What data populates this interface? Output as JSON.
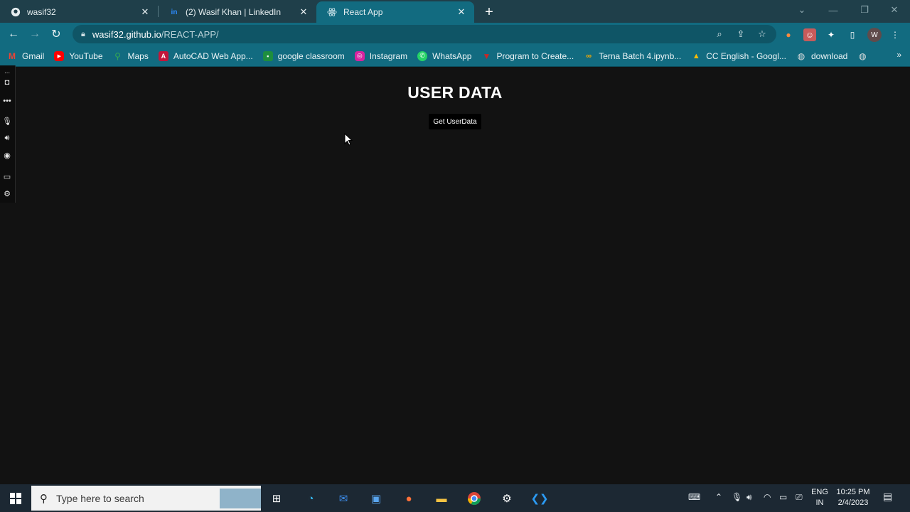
{
  "tabs": [
    {
      "title": "wasif32",
      "icon": "github-icon",
      "active": false
    },
    {
      "title": "(2) Wasif Khan | LinkedIn",
      "icon": "linkedin-icon",
      "active": false
    },
    {
      "title": "React App",
      "icon": "react-icon",
      "active": true
    }
  ],
  "address": {
    "host": "wasif32.github.io",
    "path": "/REACT-APP/"
  },
  "profile_initial": "W",
  "bookmarks": [
    {
      "label": "Gmail",
      "icon": "gmail-icon",
      "color": "#d93025"
    },
    {
      "label": "YouTube",
      "icon": "youtube-icon",
      "color": "#ff0000"
    },
    {
      "label": "Maps",
      "icon": "maps-icon",
      "color": "#34a853"
    },
    {
      "label": "AutoCAD Web App...",
      "icon": "autocad-icon",
      "color": "#c4163a"
    },
    {
      "label": "google classroom",
      "icon": "classroom-icon",
      "color": "#1e8e3e"
    },
    {
      "label": "Instagram",
      "icon": "instagram-icon",
      "color": "#d6249f"
    },
    {
      "label": "WhatsApp",
      "icon": "whatsapp-icon",
      "color": "#25d366"
    },
    {
      "label": "Program to Create...",
      "icon": "program-icon",
      "color": "#c62828"
    },
    {
      "label": "Terna Batch 4.ipynb...",
      "icon": "colab-icon",
      "color": "#f9ab00"
    },
    {
      "label": "CC English - Googl...",
      "icon": "drive-icon",
      "color": "#fbbc04"
    },
    {
      "label": "download",
      "icon": "globe-icon",
      "color": "#e0e0e0"
    }
  ],
  "page": {
    "title": "USER DATA",
    "button_label": "Get UserData"
  },
  "taskbar": {
    "search_placeholder": "Type here to search",
    "lang_line1": "ENG",
    "lang_line2": "IN",
    "time": "10:25 PM",
    "date": "2/4/2023"
  }
}
